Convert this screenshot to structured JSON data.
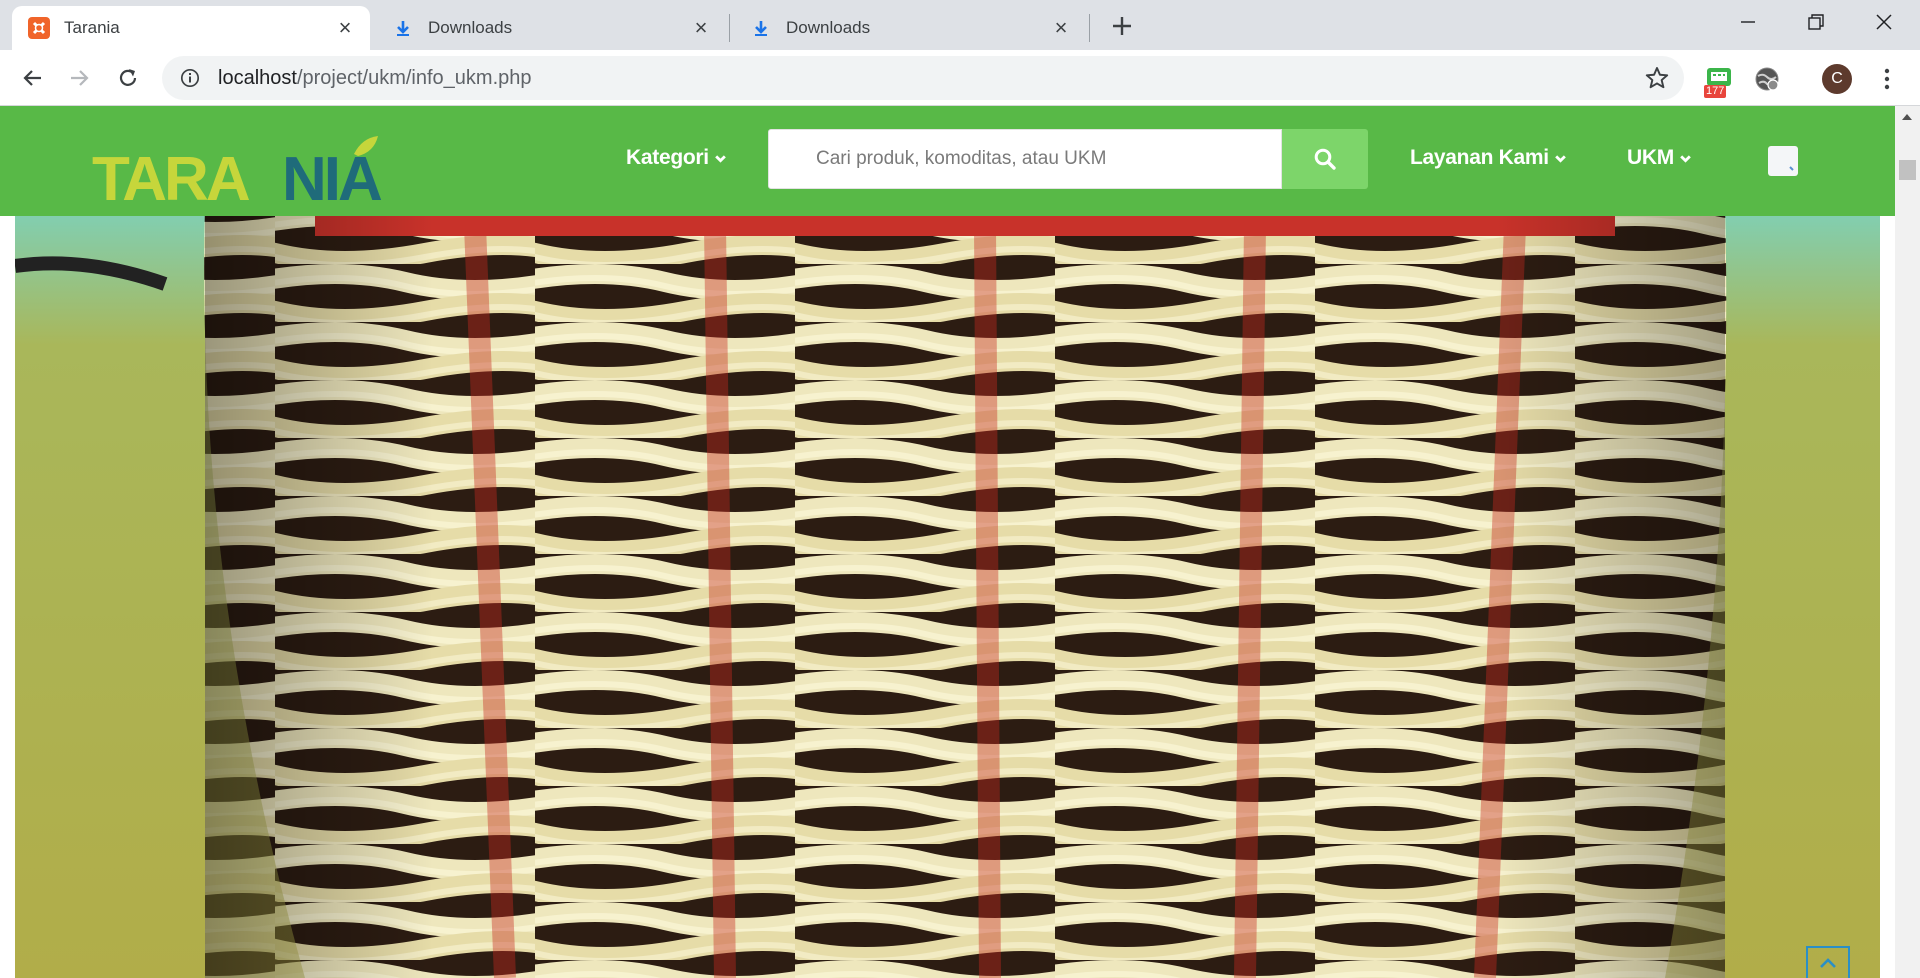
{
  "browser": {
    "tabs": [
      {
        "title": "Tarania",
        "favicon": "xampp-icon",
        "active": true
      },
      {
        "title": "Downloads",
        "favicon": "download-icon",
        "active": false
      },
      {
        "title": "Downloads",
        "favicon": "download-icon",
        "active": false
      }
    ],
    "url_host": "localhost",
    "url_path": "/project/ukm/info_ukm.php",
    "extension_badge": "177",
    "profile_initial": "C"
  },
  "site": {
    "logo_text_part1": "TARA",
    "logo_text_part2": "NIA",
    "nav": {
      "kategori": "Kategori",
      "layanan": "Layanan Kami",
      "ukm": "UKM"
    },
    "search_placeholder": "Cari produk, komoditas, atau UKM"
  },
  "colors": {
    "navbar": "#58b947",
    "search_button": "#7dd56a",
    "logo_yellow": "#c6d63b",
    "logo_teal": "#1f6b7a",
    "scroll_top_border": "#2a8fc7"
  },
  "hero_image": "woven-rattan-basket"
}
